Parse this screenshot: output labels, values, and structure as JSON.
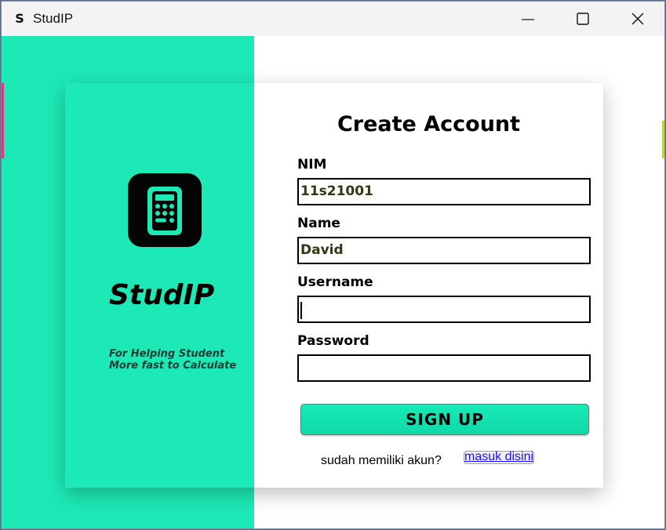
{
  "window": {
    "title": "StudIP",
    "app_icon_glyph": "S"
  },
  "left_panel": {
    "brand_name": "StudIP",
    "tagline": "For Helping Student\nMore fast to Calculate",
    "icon": "calculator-icon"
  },
  "form": {
    "title": "Create Account",
    "fields": [
      {
        "label": "NIM",
        "value": "11s21001"
      },
      {
        "label": "Name",
        "value": "David"
      },
      {
        "label": "Username",
        "value": ""
      },
      {
        "label": "Password",
        "value": ""
      }
    ],
    "submit_label": "SIGN UP",
    "footer_text": "sudah memiliki akun?",
    "login_link": "masuk disini"
  },
  "colors": {
    "accent": "#1de9b6",
    "link": "#1a0dff"
  }
}
